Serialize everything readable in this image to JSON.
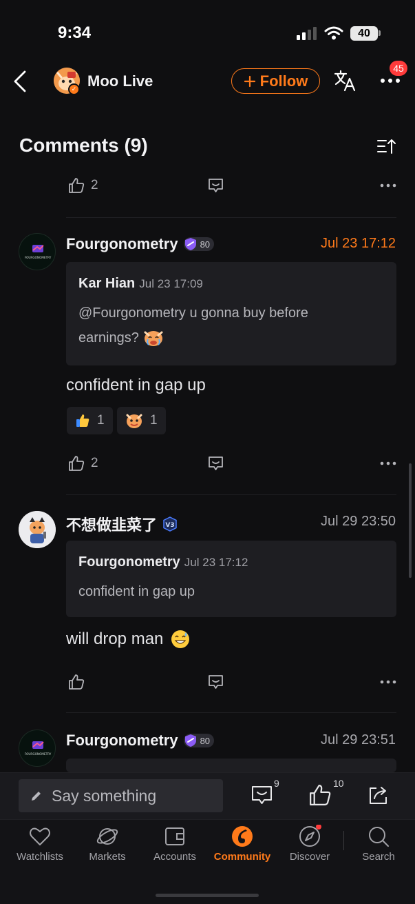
{
  "status_bar": {
    "time": "9:34",
    "battery": "40"
  },
  "header": {
    "title": "Moo Live",
    "follow_label": "Follow",
    "notification_count": "45"
  },
  "comments_header": {
    "title": "Comments (9)"
  },
  "top_partial": {
    "likes": "2"
  },
  "comments": [
    {
      "author": "Fourgonometry",
      "level": "80",
      "time": "Jul 23 17:12",
      "avatar_logo": "FOURGONOMETRY",
      "quote": {
        "author": "Kar Hian",
        "time": "Jul 23 17:09",
        "body_line1": "@Fourgonometry u gonna buy before",
        "body_line2": "earnings?"
      },
      "body": "confident in gap up",
      "reactions": [
        {
          "icon": "thumbs-up-emoji",
          "count": "1"
        },
        {
          "icon": "moo-face-emoji",
          "count": "1"
        }
      ],
      "likes": "2"
    },
    {
      "author": "不想做韭菜了",
      "time": "Jul 29 23:50",
      "quote": {
        "author": "Fourgonometry",
        "time": "Jul 23 17:12",
        "body_line1": "confident in gap up"
      },
      "body": "will drop man",
      "likes": ""
    },
    {
      "author": "Fourgonometry",
      "level": "80",
      "time": "Jul 29 23:51",
      "avatar_logo": "FOURGONOMETRY"
    }
  ],
  "comment_bar": {
    "placeholder": "Say something",
    "comment_count": "9",
    "like_count": "10"
  },
  "tabs": [
    {
      "label": "Watchlists",
      "icon": "heart-icon"
    },
    {
      "label": "Markets",
      "icon": "planet-icon"
    },
    {
      "label": "Accounts",
      "icon": "wallet-icon"
    },
    {
      "label": "Community",
      "icon": "community-icon",
      "active": true
    },
    {
      "label": "Discover",
      "icon": "compass-icon"
    },
    {
      "label": "Search",
      "icon": "search-icon"
    }
  ],
  "colors": {
    "accent": "#ff7a1a",
    "background": "#0f0f11",
    "badge_red": "#ff3b3b",
    "level_purple": "#8b5cf6"
  }
}
